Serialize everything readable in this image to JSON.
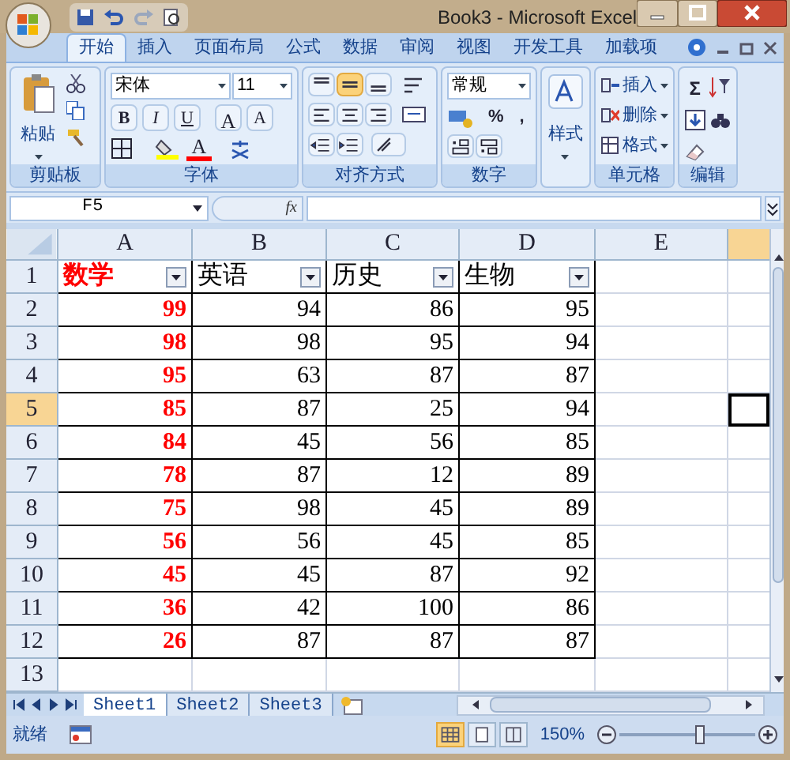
{
  "window": {
    "title": "Book3 - Microsoft Excel"
  },
  "ribbon_tabs": [
    {
      "label": "开始",
      "selected": true
    },
    {
      "label": "插入",
      "selected": false
    },
    {
      "label": "页面布局",
      "selected": false
    },
    {
      "label": "公式",
      "selected": false
    },
    {
      "label": "数据",
      "selected": false
    },
    {
      "label": "审阅",
      "selected": false
    },
    {
      "label": "视图",
      "selected": false
    },
    {
      "label": "开发工具",
      "selected": false
    },
    {
      "label": "加载项",
      "selected": false
    }
  ],
  "ribbon": {
    "clipboard": {
      "paste_label": "粘贴",
      "group_label": "剪贴板"
    },
    "font": {
      "font_name": "宋体",
      "font_size": "11",
      "bold": "B",
      "italic": "I",
      "underline": "U",
      "grow": "A",
      "shrink": "A",
      "color_letter": "A",
      "group_label": "字体"
    },
    "alignment": {
      "buttons": [
        {
          "kind": "top",
          "selected": false
        },
        {
          "kind": "middle",
          "selected": true
        },
        {
          "kind": "bottom",
          "selected": false
        }
      ],
      "group_label": "对齐方式"
    },
    "number": {
      "format": "常规",
      "percent": "%",
      "comma": ",",
      "group_label": "数字"
    },
    "styles": {
      "label": "样式"
    },
    "cells": {
      "items": [
        "插入",
        "删除",
        "格式"
      ],
      "group_label": "单元格"
    },
    "editing": {
      "sum": "Σ",
      "group_label": "编辑"
    }
  },
  "formula_bar": {
    "name_box": "F5",
    "fx": "fx"
  },
  "sheet": {
    "columns": [
      {
        "label": "A",
        "color": "#ff0000",
        "selected": false
      },
      {
        "label": "B",
        "color": "#000000",
        "selected": false
      },
      {
        "label": "C",
        "color": "#000000",
        "selected": false
      },
      {
        "label": "D",
        "color": "#000000",
        "selected": false
      },
      {
        "label": "E",
        "selected": false
      }
    ],
    "partial_column": {
      "selected": true
    },
    "rows": [
      {
        "number": "1",
        "kind": "header",
        "selected": false,
        "cells": [
          "数学",
          "英语",
          "历史",
          "生物"
        ]
      },
      {
        "number": "2",
        "kind": "data",
        "selected": false,
        "cells": [
          "99",
          "94",
          "86",
          "95"
        ]
      },
      {
        "number": "3",
        "kind": "data",
        "selected": false,
        "cells": [
          "98",
          "98",
          "95",
          "94"
        ]
      },
      {
        "number": "4",
        "kind": "data",
        "selected": false,
        "cells": [
          "95",
          "63",
          "87",
          "87"
        ]
      },
      {
        "number": "5",
        "kind": "data",
        "selected": true,
        "cells": [
          "85",
          "87",
          "25",
          "94"
        ]
      },
      {
        "number": "6",
        "kind": "data",
        "selected": false,
        "cells": [
          "84",
          "45",
          "56",
          "85"
        ]
      },
      {
        "number": "7",
        "kind": "data",
        "selected": false,
        "cells": [
          "78",
          "87",
          "12",
          "89"
        ]
      },
      {
        "number": "8",
        "kind": "data",
        "selected": false,
        "cells": [
          "75",
          "98",
          "45",
          "89"
        ]
      },
      {
        "number": "9",
        "kind": "data",
        "selected": false,
        "cells": [
          "56",
          "56",
          "45",
          "85"
        ]
      },
      {
        "number": "10",
        "kind": "data",
        "selected": false,
        "cells": [
          "45",
          "45",
          "87",
          "92"
        ]
      },
      {
        "number": "11",
        "kind": "data",
        "selected": false,
        "cells": [
          "36",
          "42",
          "100",
          "86"
        ]
      },
      {
        "number": "12",
        "kind": "data",
        "selected": false,
        "cells": [
          "26",
          "87",
          "87",
          "87"
        ]
      },
      {
        "number": "13",
        "kind": "empty",
        "selected": false,
        "cells": []
      }
    ]
  },
  "sheet_tabs": [
    {
      "label": "Sheet1",
      "selected": true
    },
    {
      "label": "Sheet2",
      "selected": false
    },
    {
      "label": "Sheet3",
      "selected": false
    }
  ],
  "status_bar": {
    "status": "就绪",
    "view_buttons": [
      {
        "kind": "normal",
        "selected": true
      },
      {
        "kind": "page_layout",
        "selected": false
      },
      {
        "kind": "page_break",
        "selected": false
      }
    ],
    "zoom": "150%",
    "zoom_slider": {
      "level": 0.6
    }
  }
}
